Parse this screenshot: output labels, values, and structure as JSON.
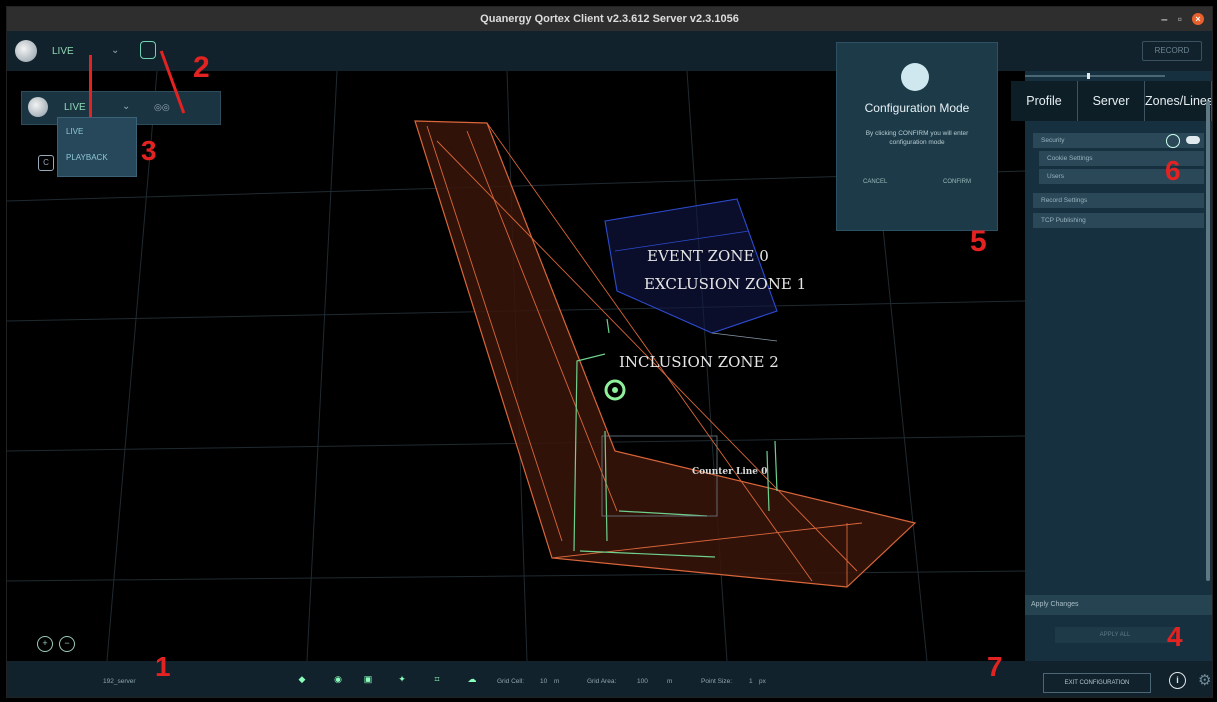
{
  "window": {
    "title": "Quanergy Qortex Client v2.3.612 Server v2.3.1056"
  },
  "toolbar": {
    "mode_label": "LIVE",
    "record_label": "RECORD"
  },
  "mode_popup": {
    "mode_label": "LIVE",
    "options": [
      "LIVE",
      "PLAYBACK"
    ]
  },
  "scene": {
    "zones": [
      "EVENT ZONE 0",
      "EXCLUSION ZONE 1",
      "INCLUSION ZONE 2"
    ],
    "count_line": "Counter Line 0"
  },
  "config_modal": {
    "title": "Configuration Mode",
    "text": "By clicking CONFIRM you will enter configuration mode",
    "cancel": "CANCEL",
    "confirm": "CONFIRM"
  },
  "right_panel": {
    "tabs": [
      "Profile",
      "Server",
      "Zones/Lines"
    ],
    "rows": [
      "Security",
      "Cookie Settings",
      "Users",
      "Record Settings",
      "TCP Publishing"
    ],
    "apply_changes": "Apply Changes",
    "apply_all": "APPLY ALL"
  },
  "bottom_bar": {
    "server_name": "192_server",
    "grid_cell_label": "Grid Cell:",
    "grid_cell_value": "10",
    "grid_cell_unit": "m",
    "grid_area_label": "Grid Area:",
    "grid_area_value": "100",
    "grid_area_unit": "m",
    "point_size_label": "Point Size:",
    "point_size_value": "1",
    "point_size_unit": "px",
    "exit_config": "EXIT CONFIGURATION"
  },
  "annotations": [
    "1",
    "2",
    "3",
    "4",
    "5",
    "6",
    "7"
  ],
  "colors": {
    "accent": "#6fd3b1",
    "annotation": "#e32222",
    "zone_edge": "#d9663a",
    "zone_fill": "#3a150a",
    "exclusion": "#2d4bd1"
  }
}
